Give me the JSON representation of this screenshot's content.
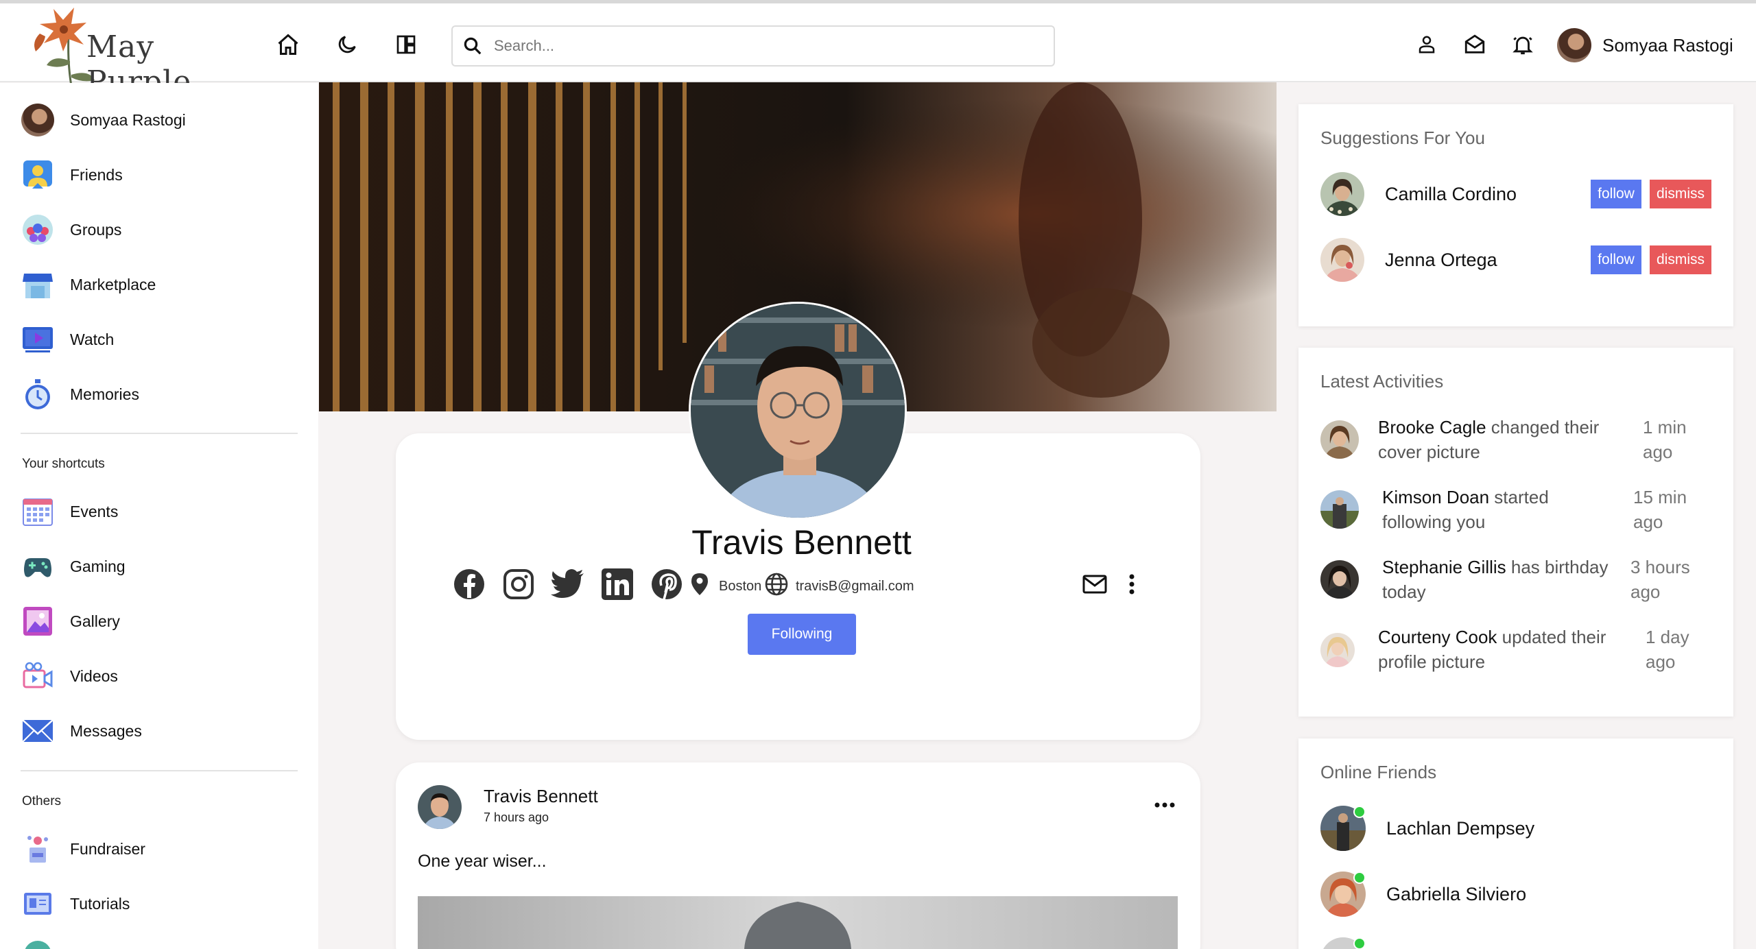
{
  "colors": {
    "accent": "#5a78f0",
    "danger": "#e8585a",
    "online": "#2ecc40"
  },
  "brand": {
    "name": "May Purple"
  },
  "nav": {
    "search_placeholder": "Search...",
    "user_name": "Somyaa Rastogi",
    "icons": [
      "home-icon",
      "moon-icon",
      "layout-icon",
      "search-icon",
      "person-icon",
      "mail-icon",
      "bell-icon"
    ]
  },
  "sidebar": {
    "user": "Somyaa Rastogi",
    "main_items": [
      {
        "label": "Friends",
        "icon": "friends-icon"
      },
      {
        "label": "Groups",
        "icon": "groups-icon"
      },
      {
        "label": "Marketplace",
        "icon": "marketplace-icon"
      },
      {
        "label": "Watch",
        "icon": "watch-icon"
      },
      {
        "label": "Memories",
        "icon": "memories-icon"
      }
    ],
    "shortcuts_heading": "Your shortcuts",
    "shortcuts": [
      {
        "label": "Events",
        "icon": "calendar-icon"
      },
      {
        "label": "Gaming",
        "icon": "gamepad-icon"
      },
      {
        "label": "Gallery",
        "icon": "gallery-icon"
      },
      {
        "label": "Videos",
        "icon": "video-icon"
      },
      {
        "label": "Messages",
        "icon": "envelope-icon"
      }
    ],
    "others_heading": "Others",
    "others": [
      {
        "label": "Fundraiser",
        "icon": "fundraiser-icon"
      },
      {
        "label": "Tutorials",
        "icon": "tutorials-icon"
      }
    ]
  },
  "profile": {
    "name": "Travis Bennett",
    "location": "Boston",
    "email": "travisB@gmail.com",
    "follow_label": "Following",
    "socials": [
      "facebook-icon",
      "instagram-icon",
      "twitter-icon",
      "linkedin-icon",
      "pinterest-icon"
    ]
  },
  "post": {
    "author": "Travis Bennett",
    "time": "7 hours ago",
    "text": "One year wiser..."
  },
  "suggestions": {
    "title": "Suggestions For You",
    "follow_label": "follow",
    "dismiss_label": "dismiss",
    "people": [
      {
        "name": "Camilla Cordino"
      },
      {
        "name": "Jenna Ortega"
      }
    ]
  },
  "activities": {
    "title": "Latest Activities",
    "items": [
      {
        "name": "Brooke Cagle",
        "action": " changed their cover picture",
        "time": "1 min ago"
      },
      {
        "name": "Kimson Doan",
        "action": " started following you",
        "time": "15 min ago"
      },
      {
        "name": "Stephanie Gillis",
        "action": " has birthday today",
        "time": "3 hours ago"
      },
      {
        "name": "Courteny Cook",
        "action": " updated their profile picture",
        "time": "1 day ago"
      }
    ]
  },
  "online": {
    "title": "Online Friends",
    "friends": [
      {
        "name": "Lachlan Dempsey"
      },
      {
        "name": "Gabriella Silviero"
      }
    ]
  }
}
